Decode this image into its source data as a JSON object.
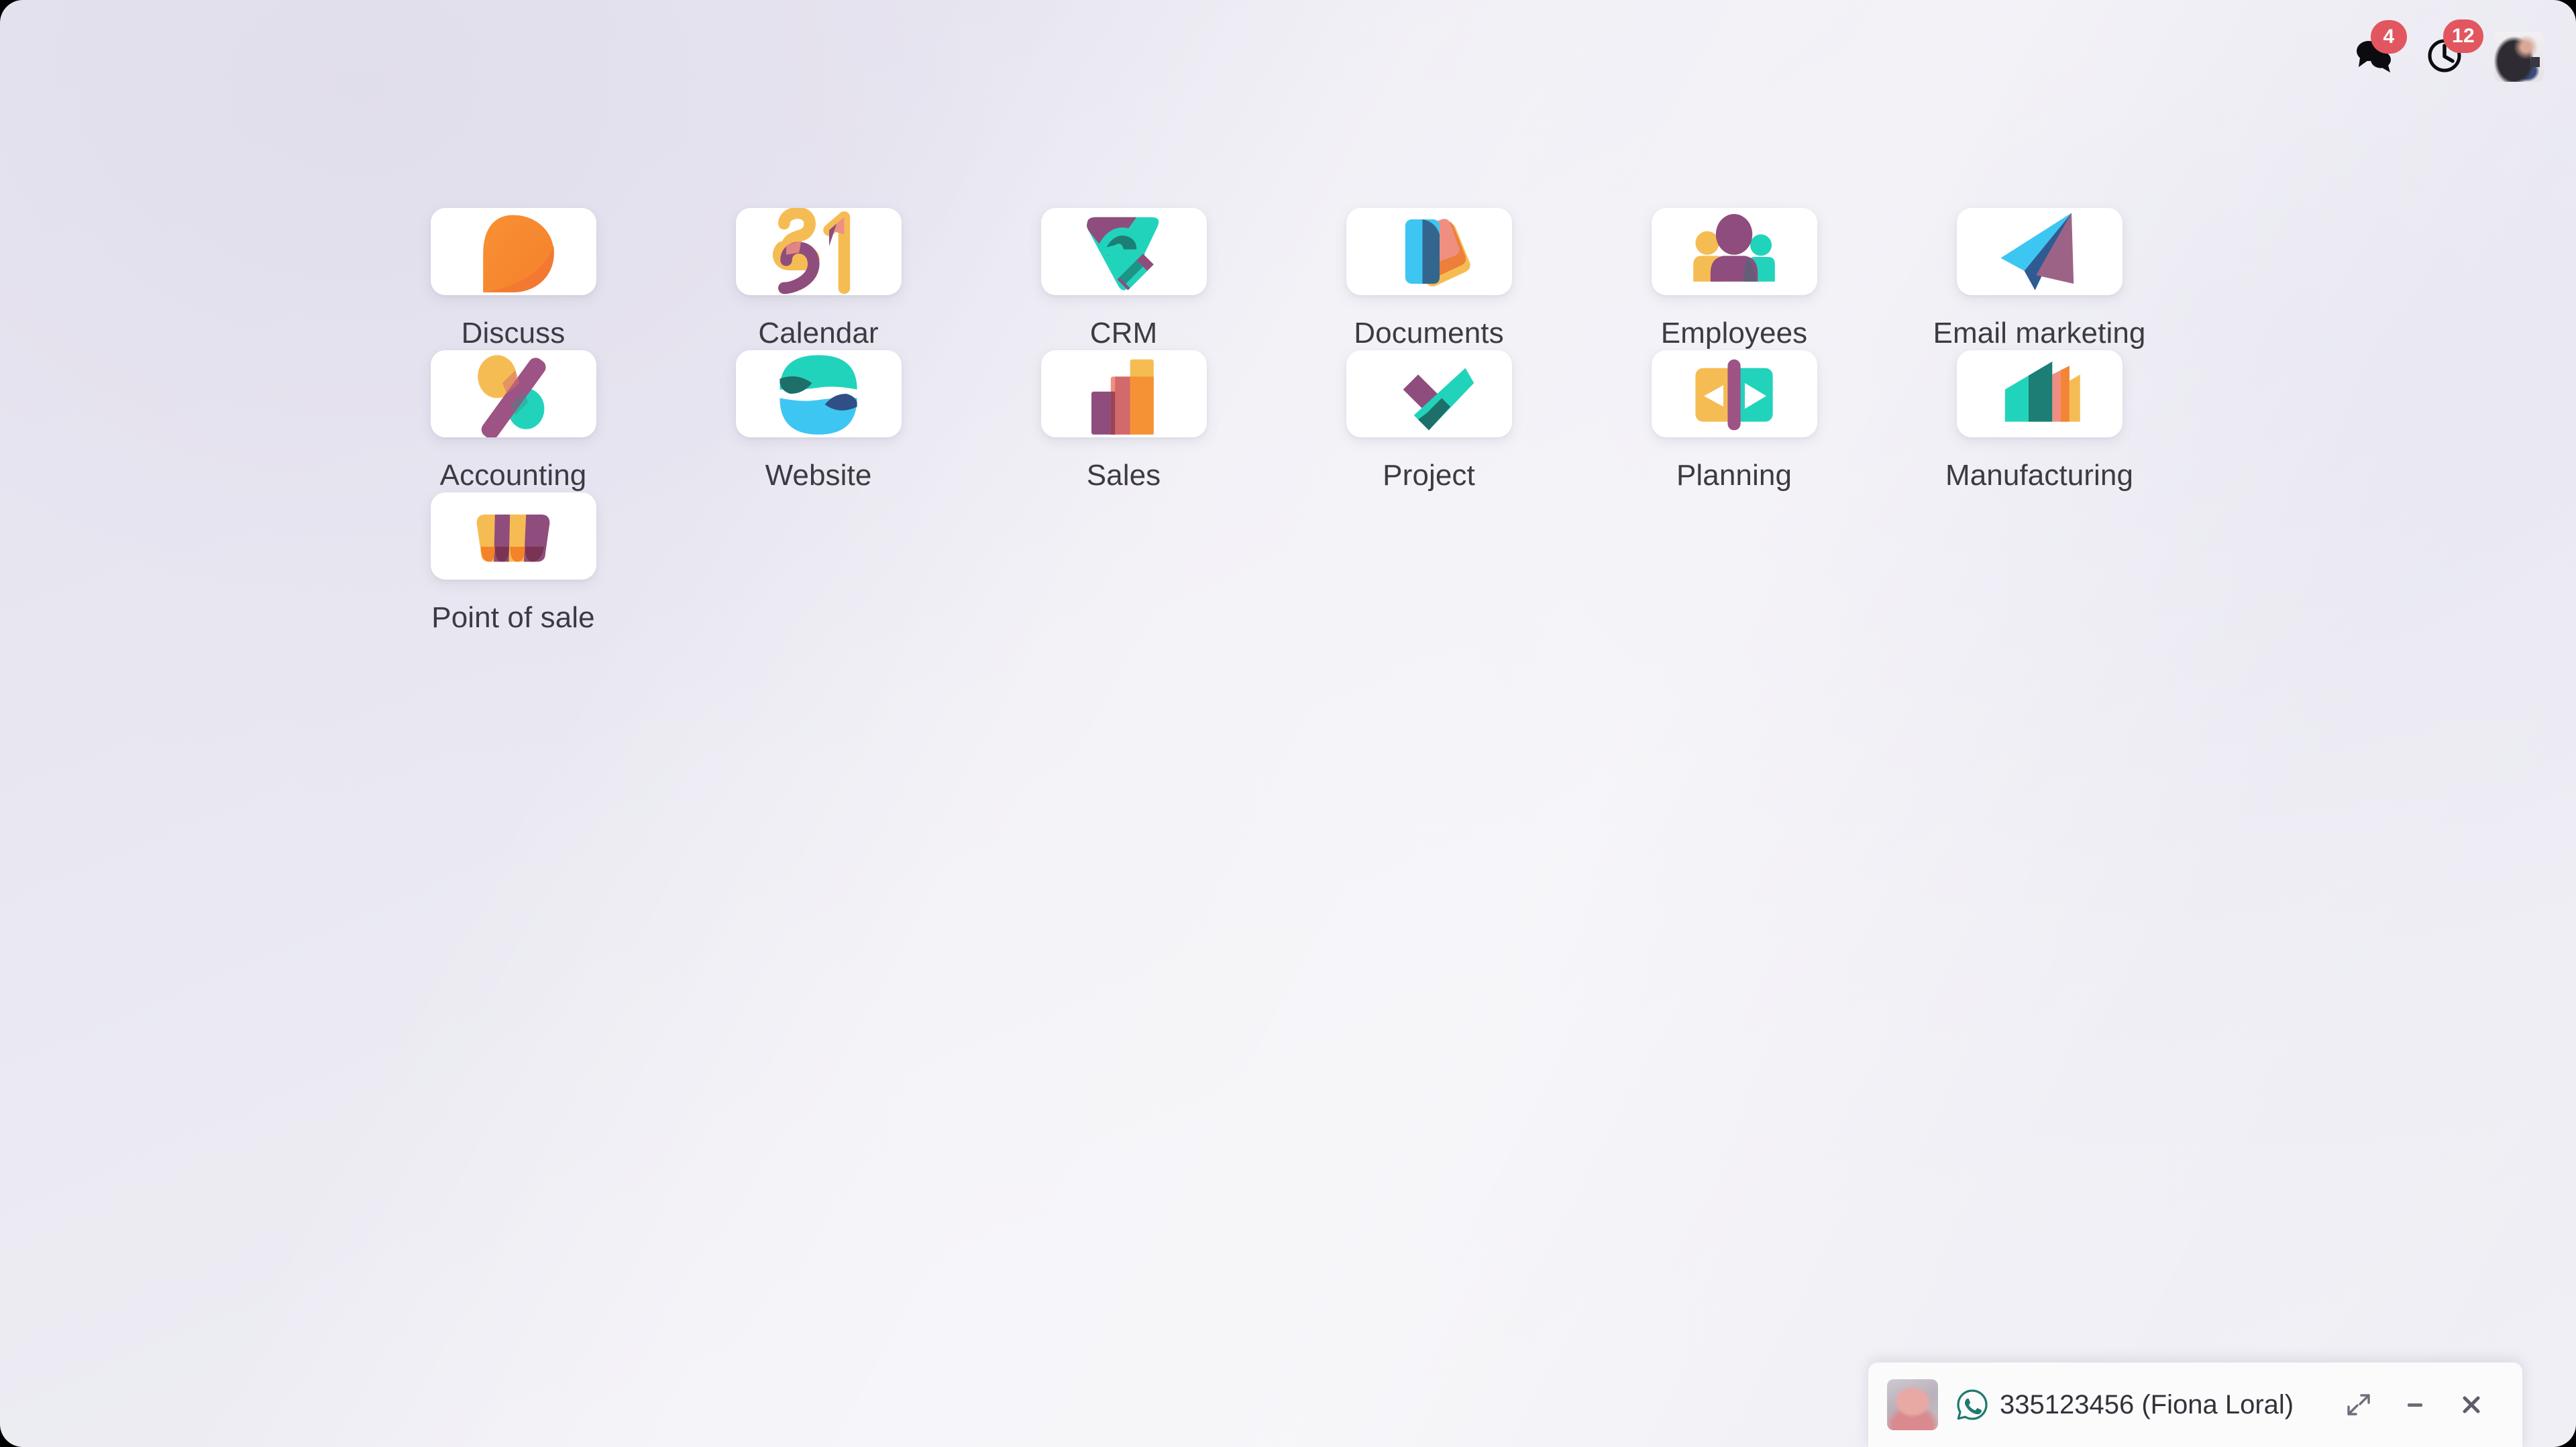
{
  "systray": {
    "messages_icon": "chat-bubbles-icon",
    "messages_count": "4",
    "activities_icon": "clock-icon",
    "activities_count": "12",
    "user_avatar": "user-avatar"
  },
  "apps": [
    {
      "name": "Discuss",
      "icon": "discuss-icon"
    },
    {
      "name": "Calendar",
      "icon": "calendar-icon"
    },
    {
      "name": "CRM",
      "icon": "crm-icon"
    },
    {
      "name": "Documents",
      "icon": "documents-icon"
    },
    {
      "name": "Employees",
      "icon": "employees-icon"
    },
    {
      "name": "Email marketing",
      "icon": "email-marketing-icon"
    },
    {
      "name": "Accounting",
      "icon": "accounting-icon"
    },
    {
      "name": "Website",
      "icon": "website-icon"
    },
    {
      "name": "Sales",
      "icon": "sales-icon"
    },
    {
      "name": "Project",
      "icon": "project-icon"
    },
    {
      "name": "Planning",
      "icon": "planning-icon"
    },
    {
      "name": "Manufacturing",
      "icon": "manufacturing-icon"
    },
    {
      "name": "Point of sale",
      "icon": "point-of-sale-icon"
    }
  ],
  "chat_window": {
    "channel_icon": "whatsapp-icon",
    "title": "335123456 (Fiona Loral)",
    "expand_label": "expand-icon",
    "minimize_label": "minimize-icon",
    "close_label": "close-icon"
  },
  "colors": {
    "badge_red": "#e2575f",
    "text_dark": "#3c3b42",
    "tile_white": "#ffffff",
    "background_lavender": "#e8e6f0",
    "whatsapp_teal": "#1f7a6e",
    "odoo_purple": "#8f4d7d",
    "odoo_teal": "#22d3bb",
    "odoo_yellow": "#f6bc54",
    "odoo_orange": "#f48229",
    "odoo_blue": "#3ec6f2"
  }
}
